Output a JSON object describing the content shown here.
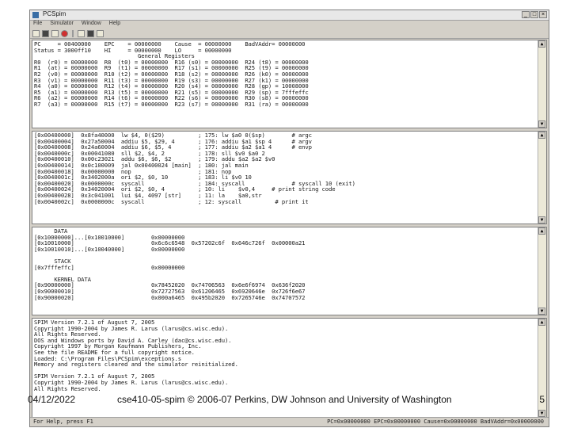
{
  "window": {
    "title": "PCSpim",
    "menu": [
      "File",
      "Simulator",
      "Window",
      "Help"
    ],
    "status_left": "For Help, press F1",
    "status_right": "PC=0x00000000  EPC=0x00000000  Cause=0x00000000  BadVAddr=0x00000000"
  },
  "toolbar_icons": [
    "open-file-icon",
    "save-icon",
    "print-icon",
    "stop-icon",
    "go-icon",
    "breakpoint-icon",
    "help-icon"
  ],
  "panes": {
    "registers": "PC     = 00400000    EPC    = 00000000    Cause  = 00000000    BadVAddr= 00000000\nStatus = 3000ff10    HI     = 00000000    LO     = 00000000\n                               General Registers\nR0  (r0) = 00000000  R8  (t0) = 00000000  R16 (s0) = 00000000  R24 (t8) = 00000000\nR1  (at) = 00000000  R9  (t1) = 00000000  R17 (s1) = 00000000  R25 (t9) = 00000000\nR2  (v0) = 00000000  R10 (t2) = 00000000  R18 (s2) = 00000000  R26 (k0) = 00000000\nR3  (v1) = 00000000  R11 (t3) = 00000000  R19 (s3) = 00000000  R27 (k1) = 00000000\nR4  (a0) = 00000000  R12 (t4) = 00000000  R20 (s4) = 00000000  R28 (gp) = 10008000\nR5  (a1) = 00000000  R13 (t5) = 00000000  R21 (s5) = 00000000  R29 (sp) = 7fffeffc\nR6  (a2) = 00000000  R14 (t6) = 00000000  R22 (s6) = 00000000  R30 (s8) = 00000000\nR7  (a3) = 00000000  R15 (t7) = 00000000  R23 (s7) = 00000000  R31 (ra) = 00000000",
    "text_segment": "[0x00400000]  0x8fa40000  lw $4, 0($29)          ; 175: lw $a0 0($sp)        # argc\n[0x00400004]  0x27a50004  addiu $5, $29, 4       ; 176: addiu $a1 $sp 4      # argv\n[0x00400008]  0x24a60004  addiu $6, $5, 4        ; 177: addiu $a2 $a1 4      # envp\n[0x0040000c]  0x00041080  sll $2, $4, 2          ; 178: sll $v0 $a0 2\n[0x00400010]  0x00c23021  addu $6, $6, $2        ; 179: addu $a2 $a2 $v0\n[0x00400014]  0x0c100009  jal 0x00400024 [main]  ; 180: jal main\n[0x00400018]  0x00000000  nop                    ; 181: nop\n[0x0040001c]  0x3402000a  ori $2, $0, 10         ; 183: li $v0 10\n[0x00400020]  0x0000000c  syscall                ; 184: syscall              # syscall 10 (exit)\n[0x00400024]  0x34020004  ori $2, $0, 4          ; 10: li    $v0,4     # print string code\n[0x00400028]  0x3c041001  lui $4, 4097 [str]     ; 11: la    $a0,str\n[0x0040002c]  0x0000000c  syscall                ; 12: syscall          # print it",
    "data_segment": "      DATA\n[0x10000000]...[0x10010000]        0x00000000\n[0x10010000]                       0x6c6c6548  0x57202c6f  0x646c726f  0x00000a21\n[0x10010010]...[0x10040000]        0x00000000\n\n      STACK\n[0x7fffeffc]                       0x00000000\n\n      KERNEL DATA\n[0x90000000]                       0x78452020  0x74706563  0x6e6f6974  0x636f2020\n[0x90000010]                       0x72727563  0x61206465  0x6920646e  0x726f6e67\n[0x90000020]                       0x000a6465  0x495b2020  0x7265746e  0x74707572",
    "messages": "SPIM Version 7.2.1 of August 7, 2005\nCopyright 1990-2004 by James R. Larus (larus@cs.wisc.edu).\nAll Rights Reserved.\nDOS and Windows ports by David A. Carley (dac@cs.wisc.edu).\nCopyright 1997 by Morgan Kaufmann Publishers, Inc.\nSee the file README for a full copyright notice.\nLoaded: C:\\Program Files\\PCSpim\\exceptions.s\nMemory and registers cleared and the simulator reinitialized.\n\nSPIM Version 7.2.1 of August 7, 2005\nCopyright 1990-2004 by James R. Larus (larus@cs.wisc.edu).\nAll Rights Reserved."
  },
  "footer": {
    "date": "04/12/2022",
    "credit": "cse410-05-spim © 2006-07 Perkins, DW Johnson and University of Washington",
    "page": "5"
  }
}
